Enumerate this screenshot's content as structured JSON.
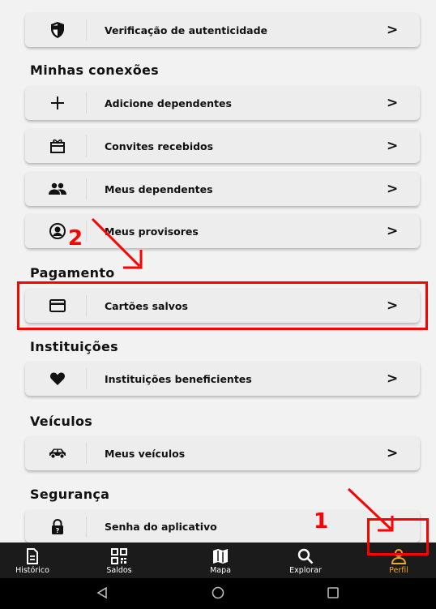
{
  "items": {
    "authenticity": {
      "label": "Verificação de autenticidade",
      "icon": "shield-icon"
    },
    "add_dependents": {
      "label": "Adicione dependentes",
      "icon": "plus-icon"
    },
    "invites": {
      "label": "Convites recebidos",
      "icon": "gift-icon"
    },
    "dependents": {
      "label": "Meus dependentes",
      "icon": "people-icon"
    },
    "providers": {
      "label": "Meus provisores",
      "icon": "account-circle-icon"
    },
    "cards": {
      "label": "Cartões salvos",
      "icon": "credit-card-icon"
    },
    "institutions": {
      "label": "Instituições beneficientes",
      "icon": "heart-icon"
    },
    "vehicles": {
      "label": "Meus veículos",
      "icon": "car-icon"
    },
    "app_password": {
      "label": "Senha do aplicativo",
      "icon": "lock-icon"
    }
  },
  "chevron": ">",
  "sections": {
    "connections": "Minhas conexões",
    "payment": "Pagamento",
    "institutions": "Instituições",
    "vehicles": "Veículos",
    "security": "Segurança"
  },
  "nav": [
    {
      "label": "Histórico",
      "icon": "history-icon"
    },
    {
      "label": "Saldos",
      "icon": "qr-code-icon"
    },
    {
      "label": "Mapa",
      "icon": "map-icon"
    },
    {
      "label": "Explorar",
      "icon": "search-icon"
    },
    {
      "label": "Perfil",
      "icon": "profile-icon",
      "active": true
    }
  ],
  "annotations": {
    "step1": "1",
    "step2": "2"
  },
  "colors": {
    "active_nav": "#f5a623",
    "annotation": "#ff0000",
    "nav_bg": "#1b1b1b"
  }
}
